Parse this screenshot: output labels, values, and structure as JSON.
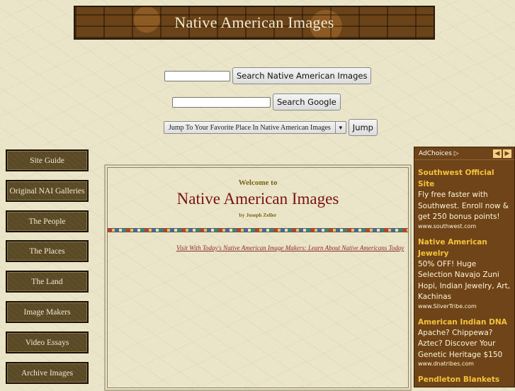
{
  "banner": {
    "title": "Native American Images"
  },
  "search_site": {
    "value": "",
    "button_label": "Search Native American Images"
  },
  "search_google": {
    "value": "",
    "button_label": "Search Google"
  },
  "jump": {
    "selected": "Jump To Your Favorite Place In Native American Images",
    "button_label": "Jump"
  },
  "nav": {
    "items": [
      {
        "label": "Site Guide"
      },
      {
        "label": "Original NAI Galleries"
      },
      {
        "label": "The People"
      },
      {
        "label": "The Places"
      },
      {
        "label": "The Land"
      },
      {
        "label": "Image Makers"
      },
      {
        "label": "Video Essays"
      },
      {
        "label": "Archive Images"
      }
    ]
  },
  "main": {
    "welcome": "Welcome to",
    "title": "Native American Images",
    "byline": "by Joseph Zeller",
    "marquee": "Visit With Today's Native American Image Makers: Learn About Native Americans Today"
  },
  "ad": {
    "choices_label": "AdChoices",
    "items": [
      {
        "headline": "Southwest Official Site",
        "text": "Fly free faster with Southwest. Enroll now & get 250 bonus points!",
        "url": "www.southwest.com"
      },
      {
        "headline": "Native American Jewelry",
        "text": "50% OFF! Huge Selection Navajo Zuni Hopi, Indian Jewelry, Art, Kachinas",
        "url": "www.SilverTribe.com"
      },
      {
        "headline": "American Indian DNA",
        "text": "Apache? Chippewa? Aztec? Discover Your Genetic Heritage $150",
        "url": "www.dnatribes.com"
      },
      {
        "headline": "Pendleton Blankets",
        "text": "",
        "url": ""
      }
    ]
  }
}
